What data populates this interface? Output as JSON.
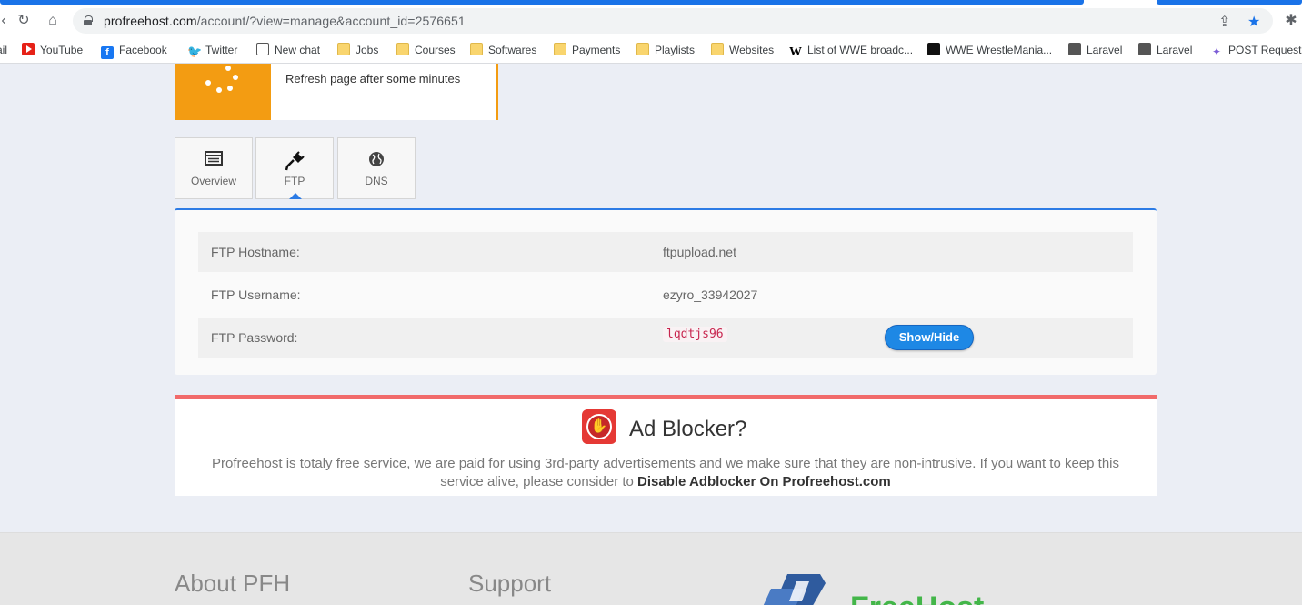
{
  "browser": {
    "url_host": "profreehost.com",
    "url_path": "/account/?view=manage&account_id=2576651",
    "bookmarks": [
      {
        "label": "ail",
        "icon": "mail-icon"
      },
      {
        "label": "YouTube",
        "icon": "youtube-icon"
      },
      {
        "label": "Facebook",
        "icon": "facebook-icon"
      },
      {
        "label": "Twitter",
        "icon": "twitter-icon"
      },
      {
        "label": "New chat",
        "icon": "chatgpt-icon"
      },
      {
        "label": "Jobs",
        "icon": "folder-icon"
      },
      {
        "label": "Courses",
        "icon": "folder-icon"
      },
      {
        "label": "Softwares",
        "icon": "folder-icon"
      },
      {
        "label": "Payments",
        "icon": "folder-icon"
      },
      {
        "label": "Playlists",
        "icon": "folder-icon"
      },
      {
        "label": "Websites",
        "icon": "folder-icon"
      },
      {
        "label": "List of WWE broadc...",
        "icon": "wikipedia-icon"
      },
      {
        "label": "WWE WrestleMania...",
        "icon": "total-icon"
      },
      {
        "label": "Laravel",
        "icon": "globe-icon"
      },
      {
        "label": "Laravel",
        "icon": "globe-icon"
      },
      {
        "label": "POST Requests",
        "icon": "post-icon"
      }
    ]
  },
  "status": {
    "text": "Refresh page after some minutes",
    "color": "#f39c12"
  },
  "tabs": [
    {
      "label": "Overview",
      "icon": "overview-icon",
      "active": false
    },
    {
      "label": "FTP",
      "icon": "plug-icon",
      "active": true
    },
    {
      "label": "DNS",
      "icon": "globe-icon",
      "active": false
    }
  ],
  "ftp": {
    "hostname_label": "FTP Hostname:",
    "hostname": "ftpupload.net",
    "username_label": "FTP Username:",
    "username": "ezyro_33942027",
    "password_label": "FTP Password:",
    "password": "lqdtjs96",
    "toggle_label": "Show/Hide"
  },
  "adblock": {
    "title": "Ad Blocker?",
    "text": "Profreehost is totaly free service, we are paid for using 3rd-party advertisements and we make sure that they are non-intrusive. If you want to keep this service alive, please consider to",
    "link": "Disable Adblocker On Profreehost.com"
  },
  "footer": {
    "about": "About PFH",
    "support": "Support",
    "logo_text": "FreeHost"
  },
  "colors": {
    "accent": "#2c7be5",
    "button": "#1e88e5",
    "ad_border": "#f16a6a",
    "pending": "#f39c12"
  }
}
